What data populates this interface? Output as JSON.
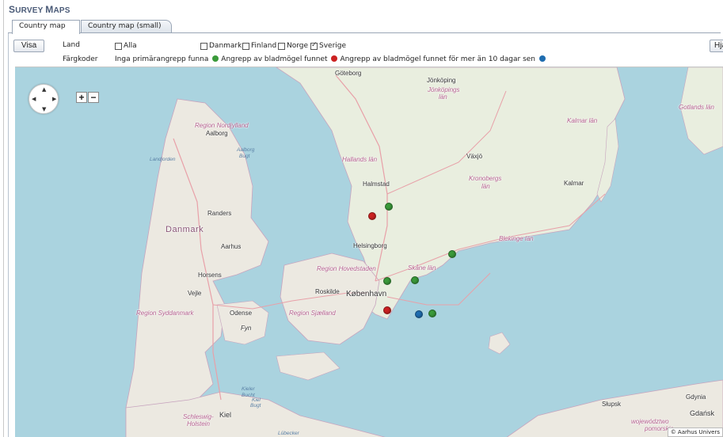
{
  "page": {
    "title_first": "S",
    "title_rest": "URVEY ",
    "title_first2": "M",
    "title_rest2": "APS"
  },
  "tabs": [
    {
      "label": "Country map",
      "active": true
    },
    {
      "label": "Country map (small)",
      "active": false
    }
  ],
  "toolbar": {
    "visa_label": "Visa",
    "help_label": "Hjälp",
    "land_label": "Land",
    "colorcodes_label": "Färgkoder"
  },
  "countries": [
    {
      "label": "Alla",
      "checked": false
    },
    {
      "label": "Danmark",
      "checked": false
    },
    {
      "label": "Finland",
      "checked": false
    },
    {
      "label": "Norge",
      "checked": false
    },
    {
      "label": "Sverige",
      "checked": true
    }
  ],
  "legend": {
    "none": "Inga primärangrepp funna",
    "found": "Angrepp av bladmögel funnet",
    "found_old": "Angrepp av bladmögel funnet för mer än 10 dagar sen",
    "colors": {
      "found": "#3a9a3a",
      "found_old": "#cc2222",
      "other": "#1f6db0"
    }
  },
  "map": {
    "controls": {
      "zoom_in": "+",
      "zoom_out": "−"
    },
    "labels": {
      "goteborg": "Göteborg",
      "jonkoping": "Jönköping",
      "jonkopings_lan_1": "Jönköpings",
      "jonkopings_lan_2": "län",
      "region_nordjylland": "Region Nordjylland",
      "gotlands_lan": "Gotlands län",
      "kalmar_lan": "Kalmar län",
      "aalborg": "Aalborg",
      "hallands_lan": "Hallands län",
      "vaxjo": "Växjö",
      "halmstad": "Halmstad",
      "kronobergs_lan_1": "Kronobergs",
      "kronobergs_lan_2": "län",
      "kalmar": "Kalmar",
      "randers": "Randers",
      "danmark": "Danmark",
      "blekinge_lan": "Blekinge län",
      "aarhus": "Aarhus",
      "helsingborg": "Helsingborg",
      "horsens": "Horsens",
      "region_hovedstaden": "Region Hovedstaden",
      "skane_lan": "Skåne län",
      "vejle": "Vejle",
      "roskilde": "Roskilde",
      "kobenhavn": "København",
      "region_syddanmark": "Region Syddanmark",
      "odense": "Odense",
      "region_sjaelland": "Region Sjælland",
      "fyn": "Fyn",
      "slupsk": "Słupsk",
      "gdynia": "Gdynia",
      "gdansk": "Gdańsk",
      "pomorskie_1": "województwo",
      "pomorskie_2": "pomorskie",
      "kiel": "Kiel",
      "schleswig_1": "Schleswig-",
      "schleswig_2": "Holstein",
      "kieler_bucht_1": "Kieler",
      "kieler_bucht_2": "Bucht",
      "kiel_bucht_1": "Kiel",
      "kiel_bucht_2": "Bugt",
      "aalborg_bugt_1": "Aalborg",
      "aalborg_bugt_2": "Bugt",
      "lubecker": "Lübecker",
      "landjorden": "Landjorden"
    },
    "markers": [
      {
        "status": "found",
        "color": "#3a9a3a"
      },
      {
        "status": "found_old",
        "color": "#cc2222"
      },
      {
        "status": "found",
        "color": "#3a9a3a"
      },
      {
        "status": "found",
        "color": "#3a9a3a"
      },
      {
        "status": "found",
        "color": "#3a9a3a"
      },
      {
        "status": "found_old",
        "color": "#cc2222"
      },
      {
        "status": "other",
        "color": "#1f6db0"
      },
      {
        "status": "found",
        "color": "#3a9a3a"
      }
    ],
    "attribution": "© Aarhus Univers"
  }
}
